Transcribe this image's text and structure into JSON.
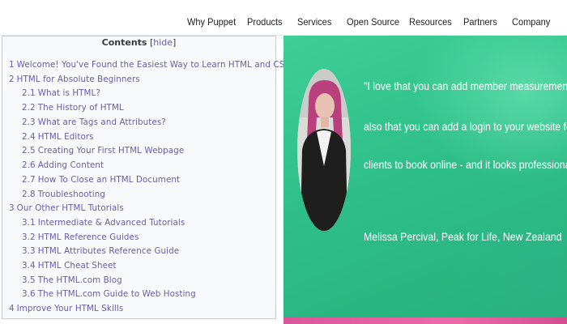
{
  "nav": {
    "items": [
      "Why Puppet",
      "Products",
      "Services",
      "Open Source",
      "Resources",
      "Partners",
      "Company"
    ]
  },
  "toc": {
    "title": "Contents",
    "toggle_open": "[",
    "toggle": "hide",
    "toggle_close": "]",
    "items": [
      {
        "num": "1",
        "text": "Welcome! You've Found the Easiest Way to Learn HTML and CSS."
      },
      {
        "num": "2",
        "text": "HTML for Absolute Beginners"
      },
      {
        "num": "2.1",
        "text": "What is HTML?"
      },
      {
        "num": "2.2",
        "text": "The History of HTML"
      },
      {
        "num": "2.3",
        "text": "What are Tags and Attributes?"
      },
      {
        "num": "2.4",
        "text": "HTML Editors"
      },
      {
        "num": "2.5",
        "text": "Creating Your First HTML Webpage"
      },
      {
        "num": "2.6",
        "text": "Adding Content"
      },
      {
        "num": "2.7",
        "text": "How To Close an HTML Document"
      },
      {
        "num": "2.8",
        "text": "Troubleshooting"
      },
      {
        "num": "3",
        "text": "Our Other HTML Tutorials"
      },
      {
        "num": "3.1",
        "text": "Intermediate & Advanced Tutorials"
      },
      {
        "num": "3.2",
        "text": "HTML Reference Guides"
      },
      {
        "num": "3.3",
        "text": "HTML Attributes Reference Guide"
      },
      {
        "num": "3.4",
        "text": "HTML Cheat Sheet"
      },
      {
        "num": "3.5",
        "text": "The HTML.com Blog"
      },
      {
        "num": "3.6",
        "text": "The HTML.com Guide to Web Hosting"
      },
      {
        "num": "4",
        "text": "Improve Your HTML Skills"
      }
    ]
  },
  "testimonial": {
    "quote_lines": [
      "\"I love that you can add member measurements, and",
      "also that you can add a login to your website for your",
      "clients to book online - and it looks professional.\""
    ],
    "attribution": "Melissa Percival, Peak for Life, New Zealand"
  },
  "colors": {
    "toc_link": "#6b5ba8",
    "hero_green": "#3ecf98",
    "hero_pink": "#ec6aa8"
  }
}
